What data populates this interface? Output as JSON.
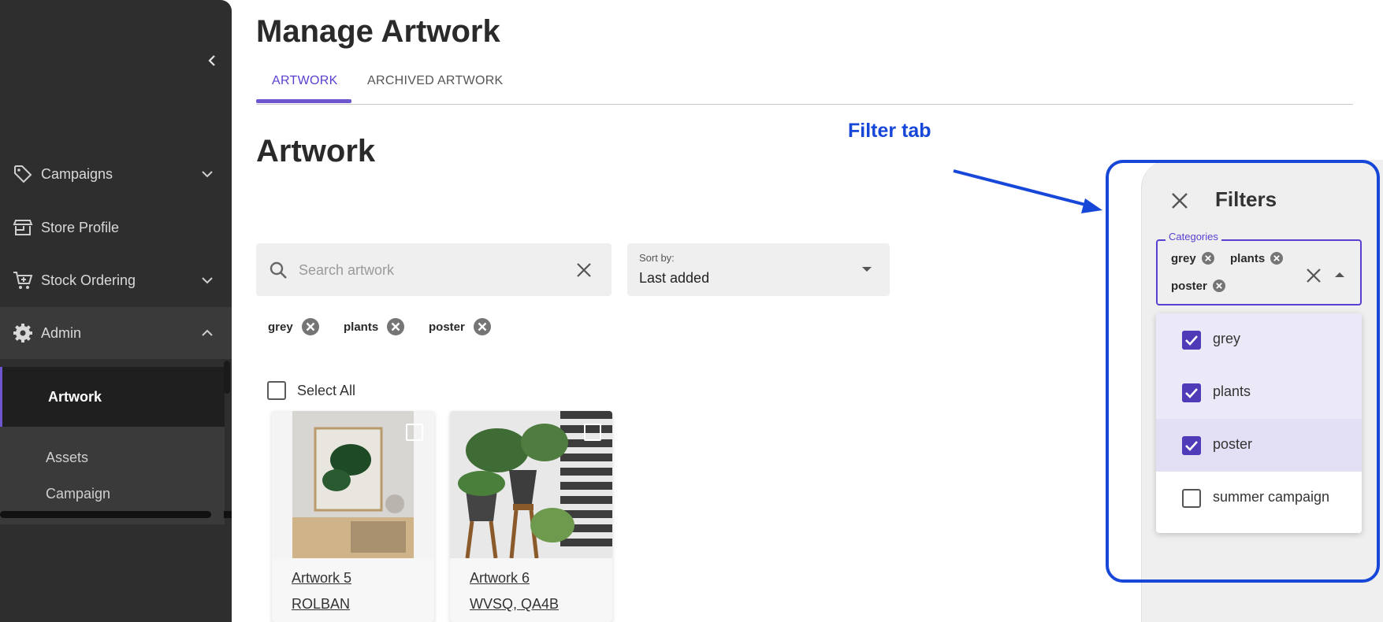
{
  "sidebar": {
    "items": [
      {
        "label": "Campaigns",
        "icon": "tag-icon",
        "expanded": false
      },
      {
        "label": "Store Profile",
        "icon": "storefront-icon"
      },
      {
        "label": "Stock Ordering",
        "icon": "cart-icon",
        "expanded": false
      },
      {
        "label": "Admin",
        "icon": "gear-icon",
        "expanded": true
      }
    ],
    "sub_items": [
      {
        "label": "Artwork",
        "active": true
      },
      {
        "label": "Assets",
        "active": false
      },
      {
        "label": "Campaign",
        "active": false
      }
    ]
  },
  "header": {
    "title": "Manage Artwork",
    "tabs": [
      {
        "label": "ARTWORK",
        "active": true
      },
      {
        "label": "ARCHIVED ARTWORK",
        "active": false
      }
    ]
  },
  "main": {
    "section_title": "Artwork",
    "search": {
      "placeholder": "Search artwork",
      "value": ""
    },
    "sort": {
      "caption": "Sort by:",
      "value": "Last added"
    },
    "active_filters": [
      "grey",
      "plants",
      "poster"
    ],
    "select_all_label": "Select All",
    "cards": [
      {
        "name": "Artwork 5",
        "code": "ROLBAN"
      },
      {
        "name": "Artwork 6",
        "code": "WVSQ, QA4B"
      }
    ]
  },
  "annotation": {
    "label": "Filter tab",
    "color": "#1747d8"
  },
  "filters": {
    "title": "Filters",
    "categories_label": "Categories",
    "selected_chips": [
      "grey",
      "plants",
      "poster"
    ],
    "options": [
      {
        "label": "grey",
        "checked": true
      },
      {
        "label": "plants",
        "checked": true
      },
      {
        "label": "poster",
        "checked": true
      },
      {
        "label": "summer campaign",
        "checked": false
      }
    ]
  },
  "colors": {
    "accent": "#6e56cf",
    "sidebar_bg": "#2e2e2e",
    "annotation_blue": "#1747d8"
  }
}
